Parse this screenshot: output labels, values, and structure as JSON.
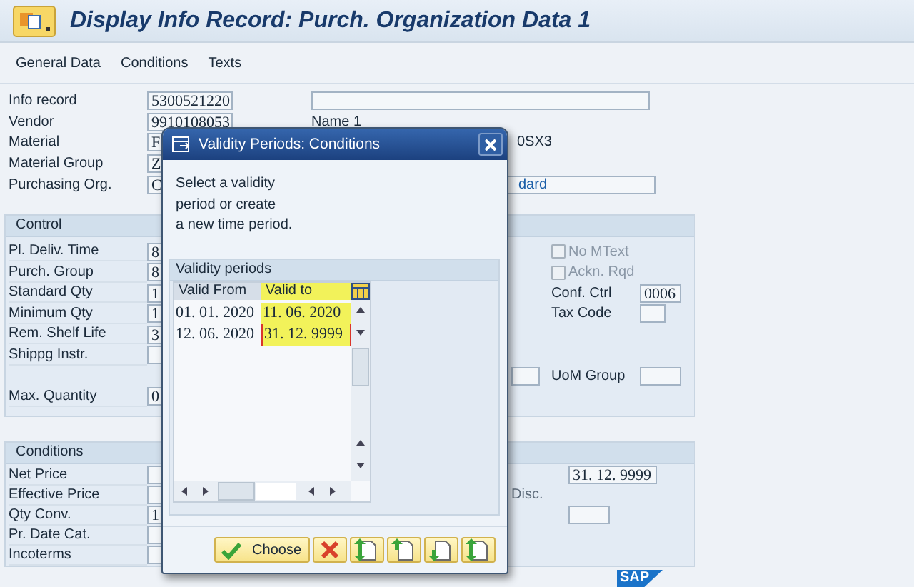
{
  "window": {
    "title": "Display Info Record: Purch. Organization Data 1"
  },
  "toolbar": [
    {
      "label": "General Data"
    },
    {
      "label": "Conditions"
    },
    {
      "label": "Texts"
    }
  ],
  "header": {
    "fields": [
      {
        "label": "Info record",
        "value": "5300521220"
      },
      {
        "label": "Vendor",
        "value": "9910108053"
      },
      {
        "label": "Material",
        "value": "F"
      },
      {
        "label": "Material Group",
        "value": "Z"
      },
      {
        "label": "Purchasing Org.",
        "value": "C"
      }
    ],
    "name_label": "Name 1",
    "name_value": "0SX3",
    "org_value": "dard"
  },
  "control": {
    "title": "Control",
    "rows": [
      {
        "label": "Pl. Deliv. Time",
        "value": "8"
      },
      {
        "label": "Purch. Group",
        "value": "8"
      },
      {
        "label": "Standard Qty",
        "value": "1"
      },
      {
        "label": "Minimum Qty",
        "value": "1"
      },
      {
        "label": "Rem. Shelf Life",
        "value": "3"
      },
      {
        "label": "Shippg Instr."
      }
    ],
    "max_quantity": {
      "label": "Max. Quantity",
      "value": "0"
    },
    "checkboxes": [
      {
        "label": "No MText",
        "checked": false,
        "disabled": true
      },
      {
        "label": "Ackn. Rqd",
        "checked": false,
        "disabled": true
      }
    ],
    "conf_ctrl": {
      "label": "Conf. Ctrl",
      "value": "0006"
    },
    "tax_code": {
      "label": "Tax Code"
    },
    "uom_group": {
      "label": "UoM Group"
    }
  },
  "conditions": {
    "title": "Conditions",
    "rows": [
      {
        "label": "Net Price"
      },
      {
        "label": "Effective Price"
      },
      {
        "label": "Qty Conv.",
        "value": "1"
      },
      {
        "label": "Pr. Date Cat."
      },
      {
        "label": "Incoterms"
      }
    ],
    "valid_to": "31. 12. 9999",
    "disc_label": "Disc."
  },
  "dialog": {
    "title": "Validity Periods: Conditions",
    "message": "Select a validity\nperiod or create\na new time period.",
    "group_title": "Validity periods",
    "columns": [
      {
        "label": "Valid From",
        "highlighted": false
      },
      {
        "label": "Valid to",
        "highlighted": true
      }
    ],
    "rows": [
      {
        "cells": [
          {
            "text": "01. 01. 2020",
            "highlighted": false,
            "focused": false
          },
          {
            "text": "11. 06. 2020",
            "highlighted": true,
            "focused": false
          }
        ]
      },
      {
        "cells": [
          {
            "text": "12. 06. 2020",
            "highlighted": false,
            "focused": false
          },
          {
            "text": "31. 12. 9999",
            "highlighted": true,
            "focused": true
          }
        ]
      }
    ],
    "buttons": [
      {
        "kind": "choose",
        "label": "Choose"
      },
      {
        "kind": "cancel"
      },
      {
        "kind": "both"
      },
      {
        "kind": "up"
      },
      {
        "kind": "down"
      },
      {
        "kind": "both"
      }
    ]
  },
  "logo": {
    "text": "SAP"
  }
}
